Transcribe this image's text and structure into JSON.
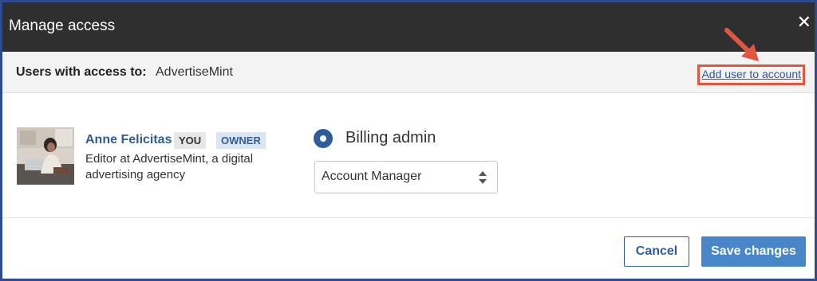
{
  "dialog": {
    "title": "Manage access",
    "close_icon": "close-icon"
  },
  "access_bar": {
    "label": "Users with access to:",
    "account_name": "AdvertiseMint",
    "add_user_link": "Add user to account"
  },
  "user": {
    "name": "Anne Felicitas",
    "badges": [
      "YOU",
      "OWNER"
    ],
    "description": "Editor at AdvertiseMint, a digital advertising agency",
    "avatar_icon": "user-avatar",
    "role_radio_label": "Billing admin",
    "role_select_value": "Account Manager"
  },
  "footer": {
    "cancel_label": "Cancel",
    "save_label": "Save changes"
  },
  "colors": {
    "titlebar": "#2f2f2f",
    "frame_border": "#2f4a8e",
    "link": "#2f55a4",
    "highlight_box": "#e0573f",
    "primary_button": "#4786c9",
    "name_text": "#2f5c9a"
  }
}
